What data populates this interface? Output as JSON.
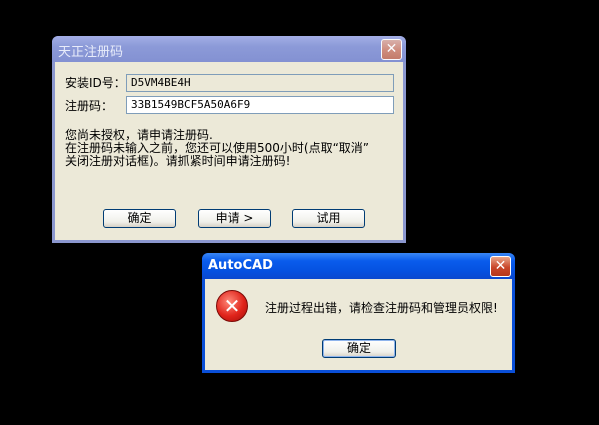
{
  "register_dialog": {
    "title": "天正注册码",
    "close_glyph": "✕",
    "install_id_label": "安装ID号：",
    "install_id_value": "D5VM4BE4H",
    "reg_code_label": "注册码：",
    "reg_code_value": "33B1549BCF5A50A6F9",
    "message_line1": "您尚未授权，请申请注册码.",
    "message_line2": "在注册码未输入之前，您还可以使用500小时(点取“取消”",
    "message_line3": "关闭注册对话框)。请抓紧时间申请注册码!",
    "ok_label": "确定",
    "apply_label": "申请 >",
    "trial_label": "试用"
  },
  "error_dialog": {
    "title": "AutoCAD",
    "close_glyph": "✕",
    "icon": "error-icon",
    "icon_glyph": "✕",
    "message": "注册过程出错，请检查注册码和管理员权限!",
    "ok_label": "确定"
  },
  "colors": {
    "desktop": "#000000",
    "dialog_face": "#ece9d8",
    "active_title": "#0551e0",
    "inactive_title": "#8c9ad8"
  }
}
